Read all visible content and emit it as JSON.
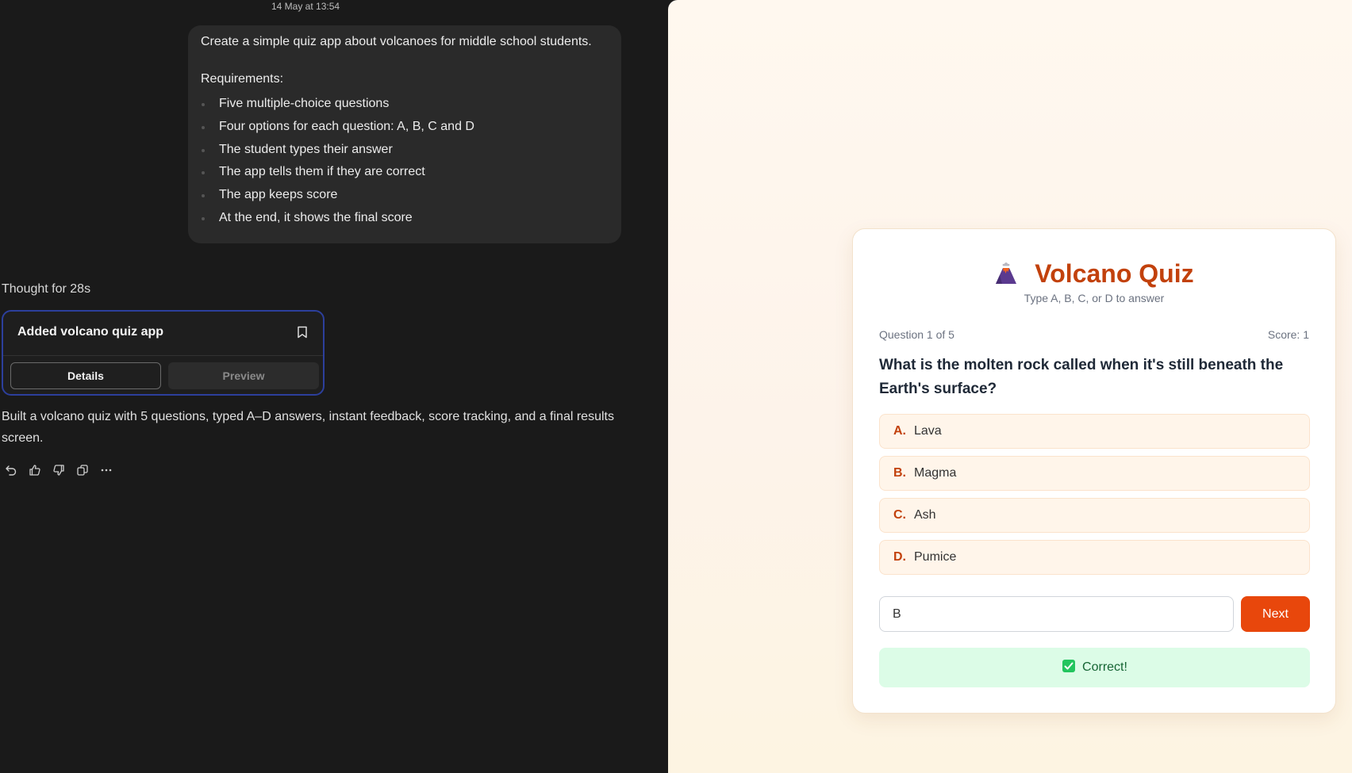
{
  "chat": {
    "timestamp": "14 May at 13:54",
    "user_message": {
      "line1": "Create a simple quiz app about volcanoes for middle school students.",
      "line2": "Requirements:",
      "requirements": [
        "Five multiple-choice questions",
        "Four options for each question: A, B, C and D",
        "The student types their answer",
        "The app tells them if they are correct",
        "The app keeps score",
        "At the end, it shows the final score"
      ]
    },
    "thought": "Thought for 28s",
    "artifact": {
      "title": "Added volcano quiz app",
      "details_label": "Details",
      "preview_label": "Preview"
    },
    "summary": "Built a volcano quiz with 5 questions, typed A–D answers, instant feedback, score tracking, and a final results screen."
  },
  "quiz": {
    "title": "Volcano Quiz",
    "subtitle": "Type A, B, C, or D to answer",
    "progress": "Question 1 of 5",
    "score": "Score: 1",
    "question": "What is the molten rock called when it's still beneath the Earth's surface?",
    "options": [
      {
        "letter": "A.",
        "text": "Lava"
      },
      {
        "letter": "B.",
        "text": "Magma"
      },
      {
        "letter": "C.",
        "text": "Ash"
      },
      {
        "letter": "D.",
        "text": "Pumice"
      }
    ],
    "answer_value": "B",
    "next_label": "Next",
    "feedback": "Correct!"
  },
  "colors": {
    "accent": "#c2410c",
    "button": "#e8470c",
    "success_bg": "#dcfce7",
    "card_border": "#2c3f9c"
  },
  "icons": [
    "volcano-icon",
    "bookmark-icon",
    "undo-icon",
    "thumbs-up-icon",
    "thumbs-down-icon",
    "copy-icon",
    "more-icon",
    "check-icon"
  ]
}
